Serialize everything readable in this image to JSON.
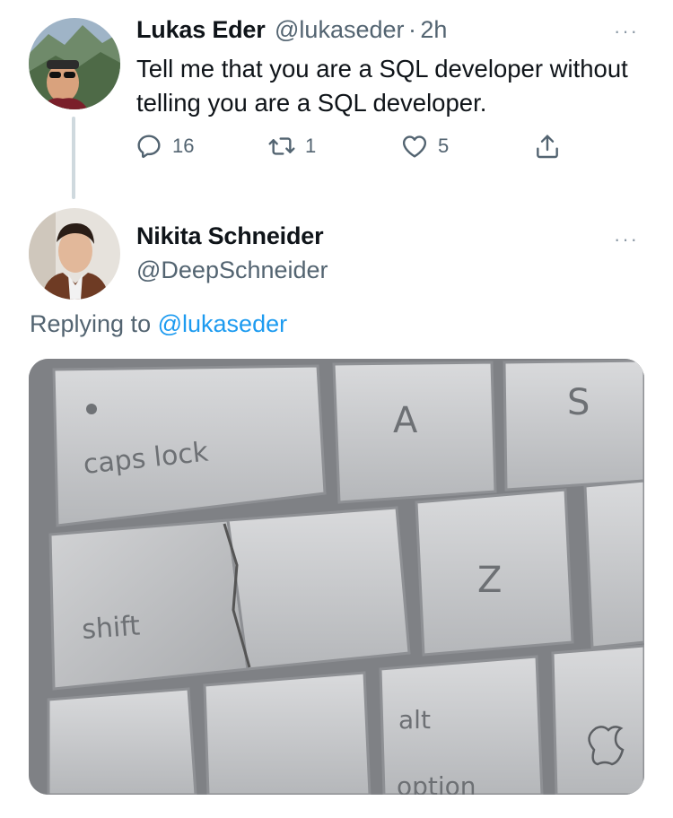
{
  "tweet": {
    "author_name": "Lukas Eder",
    "author_handle": "@lukaseder",
    "separator": "·",
    "time": "2h",
    "text": "Tell me that you are a SQL developer without telling you are a SQL developer.",
    "more_icon": "···",
    "actions": {
      "reply_icon": "reply-icon",
      "reply_count": "16",
      "retweet_icon": "retweet-icon",
      "retweet_count": "1",
      "like_icon": "heart-icon",
      "like_count": "5",
      "share_icon": "share-icon"
    }
  },
  "reply": {
    "author_name": "Nikita Schneider",
    "author_handle": "@DeepSchneider",
    "more_icon": "···",
    "replying_prefix": "Replying to",
    "replying_handle": "@lukaseder",
    "media": {
      "keys": {
        "caps": "caps lock",
        "a": "A",
        "s": "S",
        "shift": "shift",
        "z": "Z",
        "alt": "alt",
        "option": "option"
      }
    }
  },
  "colors": {
    "text_primary": "#0f1419",
    "text_secondary": "#536471",
    "link": "#1d9bf0",
    "thread_line": "#cfd9de"
  }
}
